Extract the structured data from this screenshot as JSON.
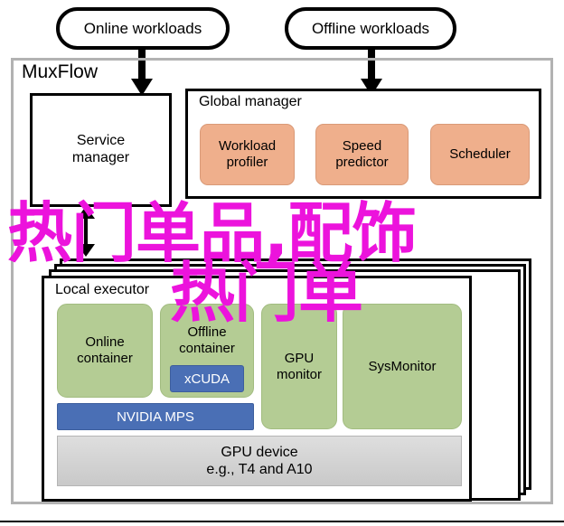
{
  "diagram": {
    "title": "MuxFlow",
    "workload_inputs": [
      {
        "label": "Online workloads"
      },
      {
        "label": "Offline workloads"
      }
    ],
    "service_manager": {
      "label": "Service\nmanager",
      "line1": "Service",
      "line2": "manager"
    },
    "global_manager": {
      "label": "Global manager",
      "modules": [
        {
          "line1": "Workload",
          "line2": "profiler"
        },
        {
          "line1": "Speed",
          "line2": "predictor"
        },
        {
          "line1": "Scheduler",
          "line2": ""
        }
      ]
    },
    "local_executor": {
      "label": "Local executor",
      "online_container": {
        "line1": "Online",
        "line2": "container"
      },
      "offline_container": {
        "line1": "Offline",
        "line2": "container"
      },
      "xcuda": "xCUDA",
      "nvidia_mps": "NVIDIA MPS",
      "gpu_monitor": {
        "line1": "GPU",
        "line2": "monitor"
      },
      "sysmonitor": "SysMonitor",
      "gpu_device": {
        "line1": "GPU device",
        "line2": "e.g., T4 and A10"
      }
    },
    "stack_count": 3
  },
  "overlay": {
    "line1": "热门单品,配饰",
    "line2": "热门单",
    "color": "#ec13dc"
  },
  "colors": {
    "peach": "#efaf8c",
    "green": "#b4cc94",
    "blue": "#4a6fb5",
    "gray_device": "#d2d2d2",
    "frame_gray": "#b2b2b2",
    "black": "#000000"
  }
}
